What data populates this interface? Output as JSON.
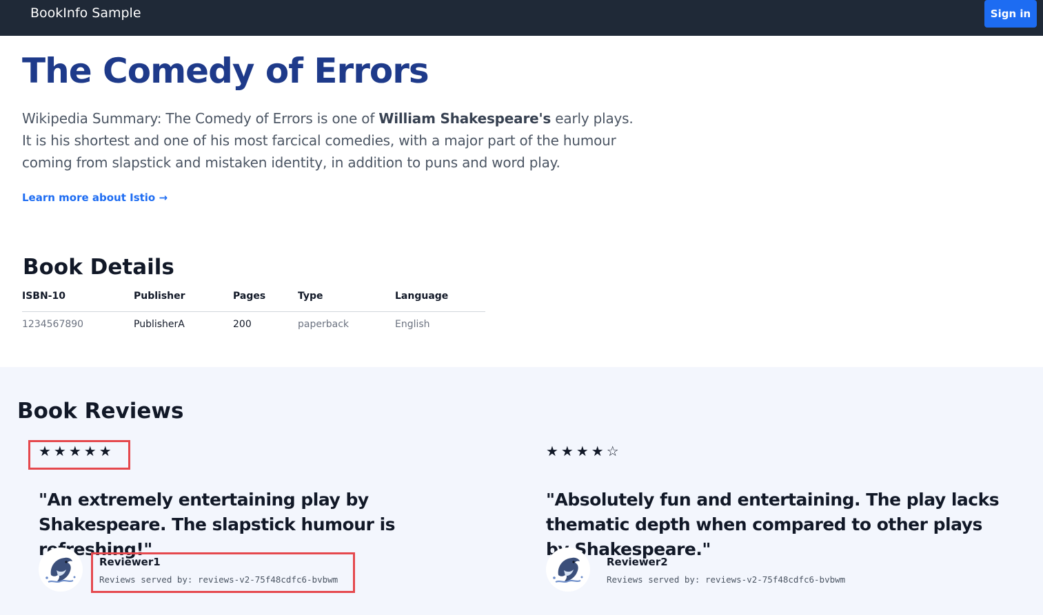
{
  "navbar": {
    "brand": "BookInfo Sample",
    "sign_in_label": "Sign in"
  },
  "book": {
    "title": "The Comedy of Errors",
    "summary_prefix": "Wikipedia Summary: The Comedy of Errors is one of ",
    "summary_bold": "William Shakespeare's",
    "summary_suffix": " early plays. It is his shortest and one of his most farcical comedies, with a major part of the humour coming from slapstick and mistaken identity, in addition to puns and word play.",
    "learn_more_label": "Learn more about Istio →"
  },
  "details": {
    "heading": "Book Details",
    "columns": [
      "ISBN-10",
      "Publisher",
      "Pages",
      "Type",
      "Language"
    ],
    "row": [
      "1234567890",
      "PublisherA",
      "200",
      "paperback",
      "English"
    ]
  },
  "reviews": {
    "heading": "Book Reviews",
    "items": [
      {
        "rating": 5,
        "max_rating": 5,
        "stars_text": "★★★★★",
        "quote": "\"An extremely entertaining play by Shakespeare. The slapstick humour is refreshing!\"",
        "reviewer": "Reviewer1",
        "served_by": "Reviews served by: reviews-v2-75f48cdfc6-bvbwm"
      },
      {
        "rating": 4,
        "max_rating": 5,
        "stars_text": "★★★★☆",
        "quote": "\"Absolutely fun and entertaining. The play lacks thematic depth when compared to other plays by Shakespeare.\"",
        "reviewer": "Reviewer2",
        "served_by": "Reviews served by: reviews-v2-75f48cdfc6-bvbwm"
      }
    ]
  },
  "icons": {
    "avatar": "dolphin-avatar-icon",
    "star_filled": "star-filled-icon",
    "star_empty": "star-outline-icon"
  },
  "colors": {
    "navbar": "#1f2937",
    "accent": "#1d6cf2",
    "title": "#1e3a8a",
    "reviews_background": "#f3f6fd",
    "highlight": "#e5484d"
  }
}
